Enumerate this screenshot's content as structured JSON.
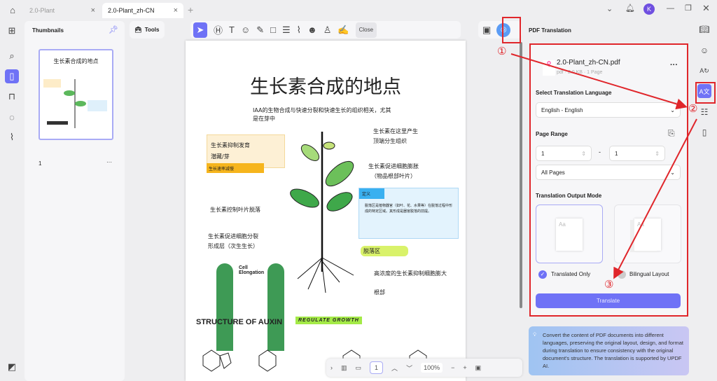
{
  "tabs": [
    {
      "label": "2.0-Plant",
      "active": false
    },
    {
      "label": "2.0-Plant_zh-CN",
      "active": true
    }
  ],
  "thumbnails": {
    "title": "Thumbnails",
    "page_number": "1",
    "more": "···"
  },
  "toolbar": {
    "tools_label": "Tools",
    "close_label": "Close"
  },
  "document": {
    "title": "生长素合成的地点",
    "intro": "IAA的生物合成与快速分裂和快速生长的组织相关，尤其是在芽中",
    "labels": {
      "produce": "生长素在这里产生",
      "meristem": "顶端分生组织",
      "expand": "生长素促进细胞膨胀",
      "expand2": "（物品根部叶片）",
      "inhibit": "生长素抑制发育",
      "inhibit2": "潜藏/芽",
      "slow": "生长速率减慢",
      "definition": "定义",
      "definition_text": "脱落区是植物器官（如叶、花、水果等）在脱落过程中形成的特定区域。其形成是器官脱落的前提。",
      "leaf_drop": "生长素控制叶片脱落",
      "divide": "生长素促进细胞分裂",
      "cambium": "形成层（次生生长）",
      "abscission": "脱落区",
      "high_conc": "高浓度的生长素抑制细胞膨大",
      "root": "根部",
      "cell_elongation": "Cell Elongation",
      "structure": "STRUCTURE OF AUXIN",
      "regulate": "REGULATE GROWTH"
    }
  },
  "bottom_bar": {
    "page": "1",
    "zoom": "100%"
  },
  "translation": {
    "header": "PDF Translation",
    "file_name": "2.0-Plant_zh-CN.pdf",
    "file_meta": "pdf · 2.0 KB · 1 Page",
    "language_label": "Select Translation Language",
    "language_value": "English - English",
    "page_range_label": "Page Range",
    "from": "1",
    "to": "1",
    "dash": "-",
    "pages_value": "All Pages",
    "output_mode_label": "Translation Output Mode",
    "mode_translated": "Translated Only",
    "mode_bilingual": "Bilingual Layout",
    "translate_button": "Translate",
    "info": "Convert the content of PDF documents into different languages, preserving the original layout, design, and format during translation to ensure consistency with the original document's structure. The translation is supported by UPDF AI."
  },
  "annotations": {
    "one": "①",
    "two": "②",
    "three": "③"
  },
  "user": {
    "avatar": "K"
  },
  "colors": {
    "accent": "#6f72f6",
    "annotation": "#e0262b"
  }
}
